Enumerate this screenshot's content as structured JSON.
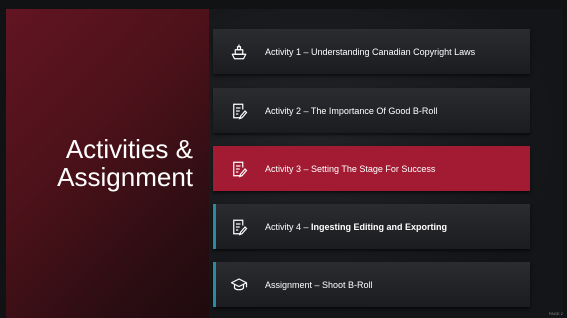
{
  "slide": {
    "title": "Activities &\nAssignment",
    "page_label": "PAGE 2"
  },
  "items": [
    {
      "icon": "ship-icon",
      "label_prefix": "Activity 1 – Understanding Canadian Copyright Laws",
      "label_bold": ""
    },
    {
      "icon": "document-pencil-icon",
      "label_prefix": "Activity 2 – The Importance Of Good B-Roll",
      "label_bold": ""
    },
    {
      "icon": "document-pencil-icon",
      "label_prefix": "Activity 3 – Setting The Stage For Success",
      "label_bold": ""
    },
    {
      "icon": "document-pencil-icon",
      "label_prefix": "Activity 4 – ",
      "label_bold": "Ingesting  Editing and Exporting"
    },
    {
      "icon": "graduation-cap-icon",
      "label_prefix": "Assignment – Shoot B-Roll",
      "label_bold": ""
    }
  ],
  "colors": {
    "active_item": "#a31a33",
    "accent_bar": "#2a8aa0",
    "left_panel": "#621522"
  }
}
